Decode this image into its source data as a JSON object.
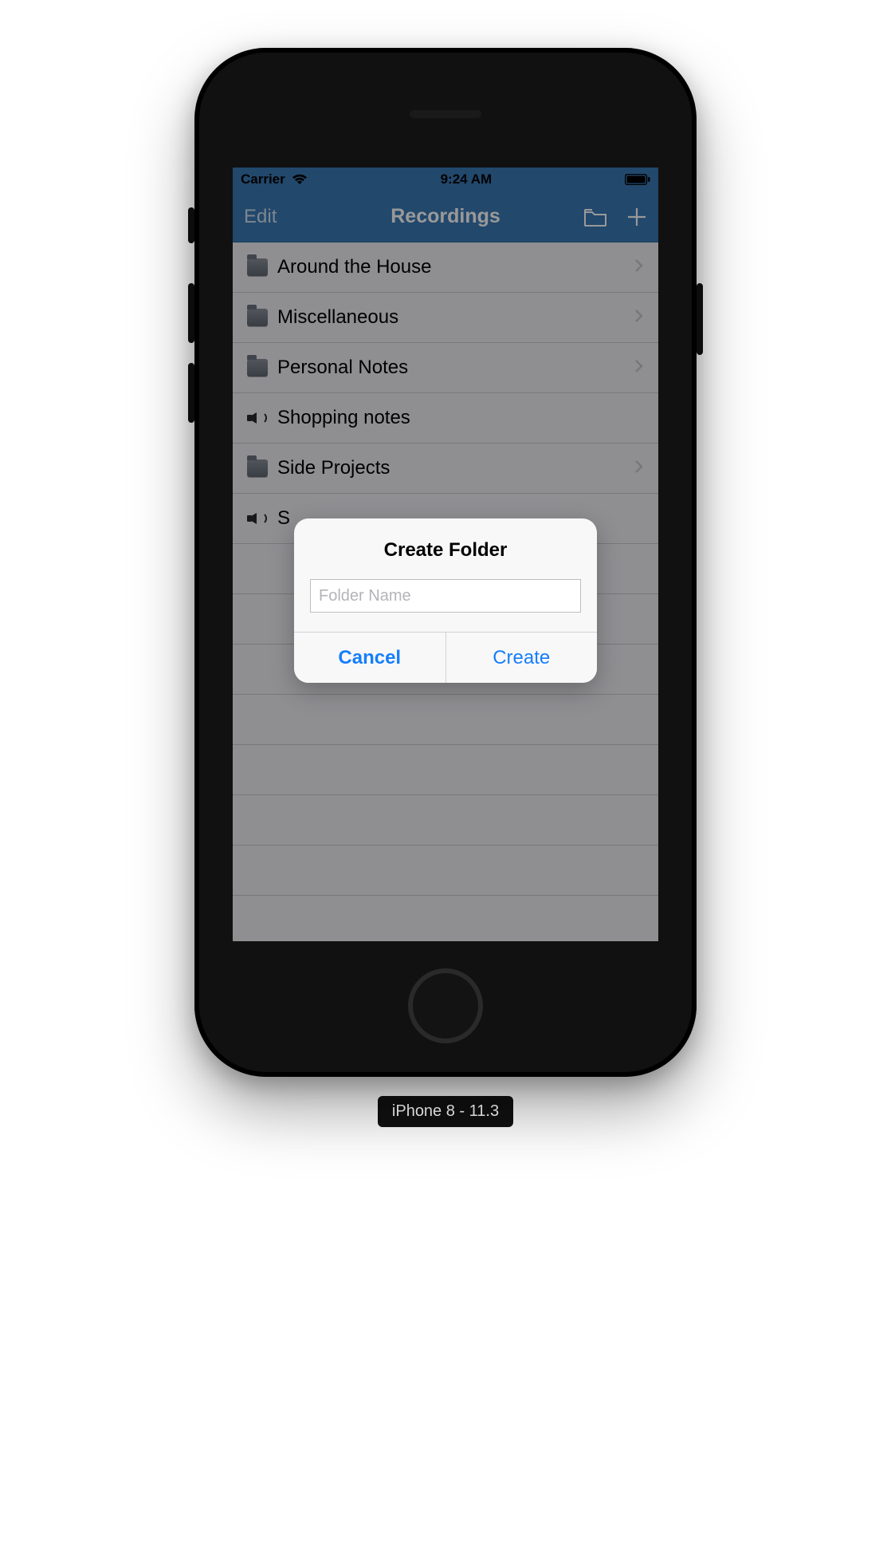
{
  "status": {
    "carrier": "Carrier",
    "time": "9:24 AM"
  },
  "nav": {
    "edit": "Edit",
    "title": "Recordings"
  },
  "rows": [
    {
      "type": "folder",
      "label": "Around the House"
    },
    {
      "type": "folder",
      "label": "Miscellaneous"
    },
    {
      "type": "folder",
      "label": "Personal Notes"
    },
    {
      "type": "audio",
      "label": "Shopping notes"
    },
    {
      "type": "folder",
      "label": "Side Projects"
    },
    {
      "type": "audio",
      "label": "S"
    }
  ],
  "alert": {
    "title": "Create Folder",
    "placeholder": "Folder Name",
    "cancel": "Cancel",
    "create": "Create"
  },
  "simulator": {
    "label": "iPhone 8 - 11.3"
  }
}
